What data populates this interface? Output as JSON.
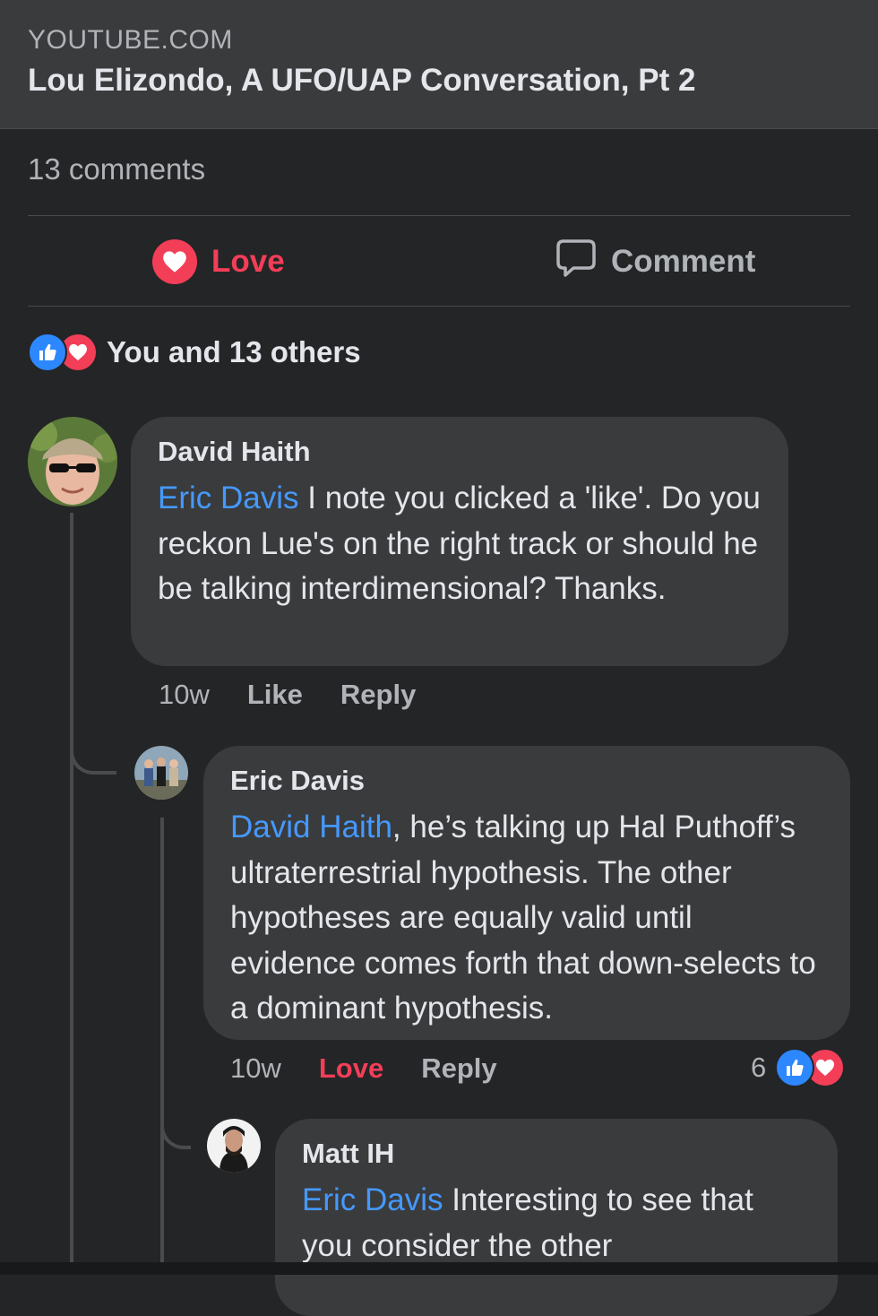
{
  "link_preview": {
    "domain": "YOUTUBE.COM",
    "title": "Lou Elizondo, A UFO/UAP Conversation, Pt 2"
  },
  "post": {
    "comment_count": "13 comments",
    "actions": {
      "love_label": "Love",
      "comment_label": "Comment"
    },
    "reactions": {
      "summary": "You and 13 others",
      "icons": [
        "like-icon",
        "love-icon"
      ]
    }
  },
  "comments": [
    {
      "author": "David Haith",
      "mention": "Eric Davis",
      "text": "  I note you clicked a 'like'. Do you reckon Lue's on the right track or should he be talking interdimensional? Thanks.",
      "time": "10w",
      "like_label": "Like",
      "reply_label": "Reply"
    },
    {
      "author": "Eric Davis",
      "mention": "David Haith",
      "text": ", he’s talking up Hal Puthoff’s ultraterrestrial hypothesis. The other hypotheses are equally valid until evidence comes forth that down-selects to a dominant hypothesis.",
      "time": "10w",
      "love_label": "Love",
      "reply_label": "Reply",
      "reaction_count": "6"
    },
    {
      "author": "Matt IH",
      "mention": "Eric Davis",
      "text": " Interesting to see that you consider the other"
    }
  ],
  "colors": {
    "background": "#242526",
    "bubble": "#3a3b3c",
    "link": "#4599ff",
    "love": "#f33e58",
    "like": "#2d88ff",
    "secondary_text": "#b0b3b8"
  }
}
